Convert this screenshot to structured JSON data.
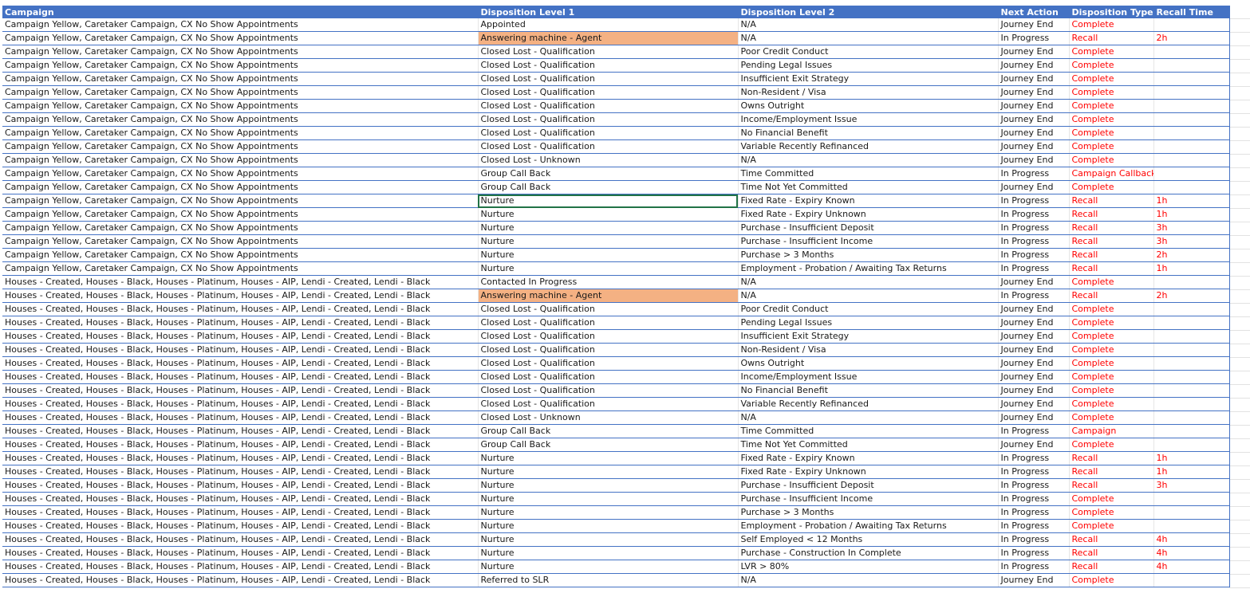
{
  "headers": [
    "Campaign",
    "Disposition Level 1",
    "Disposition Level 2",
    "Next Action",
    "Disposition Type",
    "Recall Time"
  ],
  "rows": [
    [
      "Campaign Yellow, Caretaker Campaign, CX No Show Appointments",
      "Appointed",
      "N/A",
      "Journey End",
      "Complete",
      ""
    ],
    [
      "Campaign Yellow, Caretaker Campaign, CX No Show Appointments",
      "Answering machine - Agent",
      "N/A",
      "In Progress",
      "Recall",
      "2h"
    ],
    [
      "Campaign Yellow, Caretaker Campaign, CX No Show Appointments",
      "Closed Lost - Qualification",
      "Poor Credit Conduct",
      "Journey End",
      "Complete",
      ""
    ],
    [
      "Campaign Yellow, Caretaker Campaign, CX No Show Appointments",
      "Closed Lost - Qualification",
      "Pending Legal Issues",
      "Journey End",
      "Complete",
      ""
    ],
    [
      "Campaign Yellow, Caretaker Campaign, CX No Show Appointments",
      "Closed Lost - Qualification",
      "Insufficient Exit Strategy",
      "Journey End",
      "Complete",
      ""
    ],
    [
      "Campaign Yellow, Caretaker Campaign, CX No Show Appointments",
      "Closed Lost - Qualification",
      "Non-Resident / Visa",
      "Journey End",
      "Complete",
      ""
    ],
    [
      "Campaign Yellow, Caretaker Campaign, CX No Show Appointments",
      "Closed Lost - Qualification",
      "Owns Outright",
      "Journey End",
      "Complete",
      ""
    ],
    [
      "Campaign Yellow, Caretaker Campaign, CX No Show Appointments",
      "Closed Lost - Qualification",
      "Income/Employment Issue",
      "Journey End",
      "Complete",
      ""
    ],
    [
      "Campaign Yellow, Caretaker Campaign, CX No Show Appointments",
      "Closed Lost - Qualification",
      "No Financial Benefit",
      "Journey End",
      "Complete",
      ""
    ],
    [
      "Campaign Yellow, Caretaker Campaign, CX No Show Appointments",
      "Closed Lost - Qualification",
      "Variable Recently Refinanced",
      "Journey End",
      "Complete",
      ""
    ],
    [
      "Campaign Yellow, Caretaker Campaign, CX No Show Appointments",
      "Closed Lost - Unknown",
      "N/A",
      "Journey End",
      "Complete",
      ""
    ],
    [
      "Campaign Yellow, Caretaker Campaign, CX No Show Appointments",
      "Group Call Back",
      "Time Committed",
      "In Progress",
      "Campaign Callback",
      ""
    ],
    [
      "Campaign Yellow, Caretaker Campaign, CX No Show Appointments",
      "Group Call Back",
      "Time Not Yet Committed",
      "Journey End",
      "Complete",
      ""
    ],
    [
      "Campaign Yellow, Caretaker Campaign, CX No Show Appointments",
      "Nurture",
      "Fixed Rate - Expiry Known",
      "In Progress",
      "Recall",
      "1h"
    ],
    [
      "Campaign Yellow, Caretaker Campaign, CX No Show Appointments",
      "Nurture",
      "Fixed Rate - Expiry Unknown",
      "In Progress",
      "Recall",
      "1h"
    ],
    [
      "Campaign Yellow, Caretaker Campaign, CX No Show Appointments",
      "Nurture",
      "Purchase - Insufficient Deposit",
      "In Progress",
      "Recall",
      "3h"
    ],
    [
      "Campaign Yellow, Caretaker Campaign, CX No Show Appointments",
      "Nurture",
      "Purchase - Insufficient Income",
      "In Progress",
      "Recall",
      "3h"
    ],
    [
      "Campaign Yellow, Caretaker Campaign, CX No Show Appointments",
      "Nurture",
      "Purchase > 3 Months",
      "In Progress",
      "Recall",
      "2h"
    ],
    [
      "Campaign Yellow, Caretaker Campaign, CX No Show Appointments",
      "Nurture",
      "Employment - Probation / Awaiting Tax Returns",
      "In Progress",
      "Recall",
      "1h"
    ],
    [
      "Houses - Created, Houses - Black, Houses - Platinum, Houses - AIP, Lendi - Created, Lendi - Black",
      "Contacted In Progress",
      "N/A",
      "Journey End",
      "Complete",
      ""
    ],
    [
      "Houses - Created, Houses - Black, Houses - Platinum, Houses - AIP, Lendi - Created, Lendi - Black",
      "Answering machine - Agent",
      "N/A",
      "In Progress",
      "Recall",
      "2h"
    ],
    [
      "Houses - Created, Houses - Black, Houses - Platinum, Houses - AIP, Lendi - Created, Lendi - Black",
      "Closed Lost - Qualification",
      "Poor Credit Conduct",
      "Journey End",
      "Complete",
      ""
    ],
    [
      "Houses - Created, Houses - Black, Houses - Platinum, Houses - AIP, Lendi - Created, Lendi - Black",
      "Closed Lost - Qualification",
      "Pending Legal Issues",
      "Journey End",
      "Complete",
      ""
    ],
    [
      "Houses - Created, Houses - Black, Houses - Platinum, Houses - AIP, Lendi - Created, Lendi - Black",
      "Closed Lost - Qualification",
      "Insufficient Exit Strategy",
      "Journey End",
      "Complete",
      ""
    ],
    [
      "Houses - Created, Houses - Black, Houses - Platinum, Houses - AIP, Lendi - Created, Lendi - Black",
      "Closed Lost - Qualification",
      "Non-Resident / Visa",
      "Journey End",
      "Complete",
      ""
    ],
    [
      "Houses - Created, Houses - Black, Houses - Platinum, Houses - AIP, Lendi - Created, Lendi - Black",
      "Closed Lost - Qualification",
      "Owns Outright",
      "Journey End",
      "Complete",
      ""
    ],
    [
      "Houses - Created, Houses - Black, Houses - Platinum, Houses - AIP, Lendi - Created, Lendi - Black",
      "Closed Lost - Qualification",
      "Income/Employment Issue",
      "Journey End",
      "Complete",
      ""
    ],
    [
      "Houses - Created, Houses - Black, Houses - Platinum, Houses - AIP, Lendi - Created, Lendi - Black",
      "Closed Lost - Qualification",
      "No Financial Benefit",
      "Journey End",
      "Complete",
      ""
    ],
    [
      "Houses - Created, Houses - Black, Houses - Platinum, Houses - AIP, Lendi - Created, Lendi - Black",
      "Closed Lost - Qualification",
      "Variable Recently Refinanced",
      "Journey End",
      "Complete",
      ""
    ],
    [
      "Houses - Created, Houses - Black, Houses - Platinum, Houses - AIP, Lendi - Created, Lendi - Black",
      "Closed Lost - Unknown",
      "N/A",
      "Journey End",
      "Complete",
      ""
    ],
    [
      "Houses - Created, Houses - Black, Houses - Platinum, Houses - AIP, Lendi - Created, Lendi - Black",
      "Group Call Back",
      "Time Committed",
      "In Progress",
      "Campaign",
      ""
    ],
    [
      "Houses - Created, Houses - Black, Houses - Platinum, Houses - AIP, Lendi - Created, Lendi - Black",
      "Group Call Back",
      "Time Not Yet Committed",
      "Journey End",
      "Complete",
      ""
    ],
    [
      "Houses - Created, Houses - Black, Houses - Platinum, Houses - AIP, Lendi - Created, Lendi - Black",
      "Nurture",
      "Fixed Rate - Expiry Known",
      "In Progress",
      "Recall",
      "1h"
    ],
    [
      "Houses - Created, Houses - Black, Houses - Platinum, Houses - AIP, Lendi - Created, Lendi - Black",
      "Nurture",
      "Fixed Rate - Expiry Unknown",
      "In Progress",
      "Recall",
      "1h"
    ],
    [
      "Houses - Created, Houses - Black, Houses - Platinum, Houses - AIP, Lendi - Created, Lendi - Black",
      "Nurture",
      "Purchase - Insufficient Deposit",
      "In Progress",
      "Recall",
      "3h"
    ],
    [
      "Houses - Created, Houses - Black, Houses - Platinum, Houses - AIP, Lendi - Created, Lendi - Black",
      "Nurture",
      "Purchase - Insufficient Income",
      "In Progress",
      "Complete",
      ""
    ],
    [
      "Houses - Created, Houses - Black, Houses - Platinum, Houses - AIP, Lendi - Created, Lendi - Black",
      "Nurture",
      "Purchase > 3 Months",
      "In Progress",
      "Complete",
      ""
    ],
    [
      "Houses - Created, Houses - Black, Houses - Platinum, Houses - AIP, Lendi - Created, Lendi - Black",
      "Nurture",
      "Employment - Probation / Awaiting Tax Returns",
      "In Progress",
      "Complete",
      ""
    ],
    [
      "Houses - Created, Houses - Black, Houses - Platinum, Houses - AIP, Lendi - Created, Lendi - Black",
      "Nurture",
      "Self Employed < 12 Months",
      "In Progress",
      "Recall",
      "4h"
    ],
    [
      "Houses - Created, Houses - Black, Houses - Platinum, Houses - AIP, Lendi - Created, Lendi - Black",
      "Nurture",
      "Purchase - Construction In Complete",
      "In Progress",
      "Recall",
      "4h"
    ],
    [
      "Houses - Created, Houses - Black, Houses - Platinum, Houses - AIP, Lendi - Created, Lendi - Black",
      "Nurture",
      "LVR > 80%",
      "In Progress",
      "Recall",
      "4h"
    ],
    [
      "Houses - Created, Houses - Black, Houses - Platinum, Houses - AIP, Lendi - Created, Lendi - Black",
      "Referred to SLR",
      "N/A",
      "Journey End",
      "Complete",
      ""
    ]
  ],
  "highlighted_rows": [
    1,
    20
  ],
  "selected_cell": {
    "row": 13,
    "col": 1
  },
  "colors": {
    "header_bg": "#4472c4",
    "header_text": "#ffffff",
    "row_border": "#4472c4",
    "highlight": "#f4b183",
    "red_text": "#ff0000",
    "selection": "#217346"
  }
}
